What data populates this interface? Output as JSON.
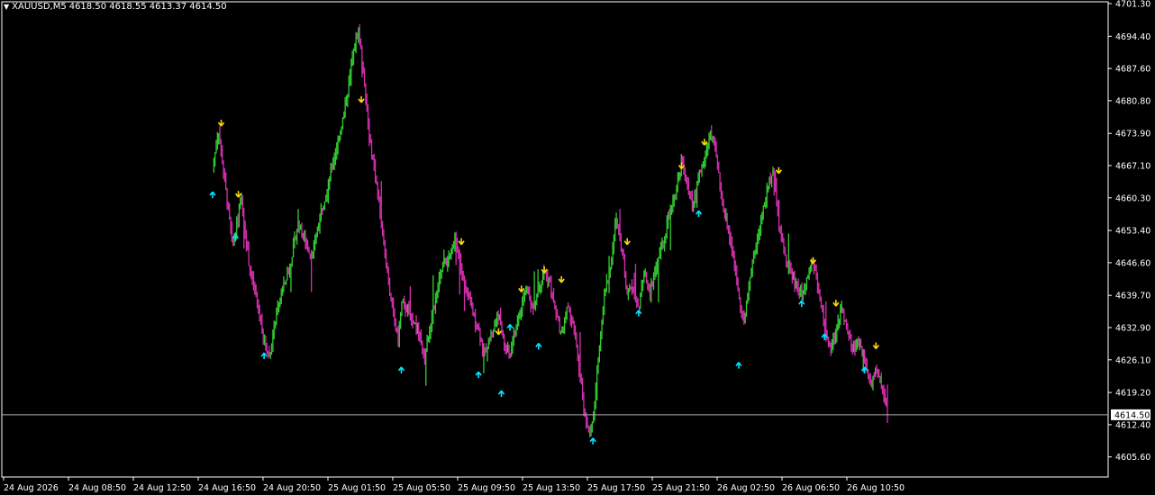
{
  "header": {
    "symbol": "XAUUSD,M5",
    "ohlc": "4618.50 4618.55 4613.37 4614.50"
  },
  "current_price": "4614.50",
  "colors": {
    "background": "#000000",
    "up": "#32cd32",
    "down": "#d62fae",
    "up_arrow": "#00e5ff",
    "down_arrow": "#ffd700",
    "axis": "#ffffff",
    "price_line": "#c0c0c0"
  },
  "chart_data": {
    "type": "candlestick",
    "symbol": "XAUUSD",
    "timeframe": "M5",
    "ylim": [
      4602.5,
      4701.3
    ],
    "y_ticks": [
      "4701.30",
      "4694.40",
      "4687.60",
      "4680.80",
      "4673.90",
      "4667.10",
      "4660.30",
      "4653.40",
      "4646.60",
      "4639.70",
      "4632.90",
      "4626.10",
      "4619.20",
      "4612.40",
      "4605.60"
    ],
    "x_ticks": [
      "24 Aug 2026",
      "24 Aug 08:50",
      "24 Aug 12:50",
      "24 Aug 16:50",
      "24 Aug 20:50",
      "25 Aug 01:50",
      "25 Aug 05:50",
      "25 Aug 09:50",
      "25 Aug 13:50",
      "25 Aug 17:50",
      "25 Aug 21:50",
      "26 Aug 02:50",
      "26 Aug 06:50",
      "26 Aug 10:50"
    ],
    "price_path": [
      [
        0.0,
        4666
      ],
      [
        0.02,
        4675
      ],
      [
        0.04,
        4665
      ],
      [
        0.07,
        4650
      ],
      [
        0.1,
        4660
      ],
      [
        0.13,
        4645
      ],
      [
        0.16,
        4637
      ],
      [
        0.18,
        4630
      ],
      [
        0.2,
        4627
      ],
      [
        0.22,
        4635
      ],
      [
        0.24,
        4640
      ],
      [
        0.27,
        4646
      ],
      [
        0.3,
        4655
      ],
      [
        0.33,
        4650
      ],
      [
        0.35,
        4648
      ],
      [
        0.38,
        4658
      ],
      [
        0.4,
        4662
      ],
      [
        0.43,
        4670
      ],
      [
        0.46,
        4678
      ],
      [
        0.49,
        4690
      ],
      [
        0.51,
        4696
      ],
      [
        0.53,
        4685
      ],
      [
        0.55,
        4672
      ],
      [
        0.57,
        4665
      ],
      [
        0.6,
        4650
      ],
      [
        0.62,
        4640
      ],
      [
        0.65,
        4630
      ],
      [
        0.66,
        4638
      ],
      [
        0.69,
        4636
      ],
      [
        0.72,
        4632
      ],
      [
        0.74,
        4626
      ],
      [
        0.77,
        4636
      ],
      [
        0.8,
        4645
      ],
      [
        0.83,
        4648
      ],
      [
        0.85,
        4652
      ],
      [
        0.87,
        4645
      ],
      [
        0.89,
        4640
      ],
      [
        0.91,
        4636
      ],
      [
        0.93,
        4633
      ],
      [
        0.95,
        4627
      ],
      [
        0.97,
        4631
      ],
      [
        1.0,
        4636
      ],
      [
        1.02,
        4629
      ],
      [
        1.04,
        4627
      ],
      [
        1.06,
        4633
      ],
      [
        1.08,
        4637
      ],
      [
        1.1,
        4642
      ],
      [
        1.12,
        4636
      ],
      [
        1.14,
        4641
      ],
      [
        1.16,
        4645
      ],
      [
        1.18,
        4642
      ],
      [
        1.2,
        4636
      ],
      [
        1.22,
        4631
      ],
      [
        1.24,
        4637
      ],
      [
        1.26,
        4634
      ],
      [
        1.28,
        4625
      ],
      [
        1.3,
        4615
      ],
      [
        1.32,
        4610
      ],
      [
        1.33,
        4613
      ],
      [
        1.35,
        4627
      ],
      [
        1.37,
        4640
      ],
      [
        1.39,
        4645
      ],
      [
        1.41,
        4656
      ],
      [
        1.43,
        4650
      ],
      [
        1.45,
        4640
      ],
      [
        1.47,
        4642
      ],
      [
        1.49,
        4637
      ],
      [
        1.51,
        4645
      ],
      [
        1.53,
        4640
      ],
      [
        1.56,
        4648
      ],
      [
        1.58,
        4652
      ],
      [
        1.6,
        4658
      ],
      [
        1.62,
        4662
      ],
      [
        1.64,
        4668
      ],
      [
        1.66,
        4663
      ],
      [
        1.68,
        4658
      ],
      [
        1.7,
        4665
      ],
      [
        1.72,
        4668
      ],
      [
        1.74,
        4674
      ],
      [
        1.76,
        4670
      ],
      [
        1.78,
        4660
      ],
      [
        1.8,
        4655
      ],
      [
        1.82,
        4648
      ],
      [
        1.84,
        4640
      ],
      [
        1.86,
        4634
      ],
      [
        1.88,
        4644
      ],
      [
        1.9,
        4650
      ],
      [
        1.92,
        4656
      ],
      [
        1.94,
        4662
      ],
      [
        1.96,
        4667
      ],
      [
        1.98,
        4655
      ],
      [
        2.0,
        4648
      ],
      [
        2.02,
        4645
      ],
      [
        2.04,
        4642
      ],
      [
        2.06,
        4640
      ],
      [
        2.08,
        4644
      ],
      [
        2.1,
        4647
      ],
      [
        2.12,
        4640
      ],
      [
        2.14,
        4633
      ],
      [
        2.16,
        4628
      ],
      [
        2.18,
        4632
      ],
      [
        2.2,
        4637
      ],
      [
        2.22,
        4632
      ],
      [
        2.24,
        4628
      ],
      [
        2.26,
        4630
      ],
      [
        2.28,
        4626
      ],
      [
        2.3,
        4621
      ],
      [
        2.32,
        4624
      ],
      [
        2.34,
        4621
      ],
      [
        2.36,
        4614.5
      ]
    ],
    "up_arrows": [
      [
        0.0,
        4661
      ],
      [
        0.08,
        4652
      ],
      [
        0.18,
        4627
      ],
      [
        0.66,
        4624
      ],
      [
        0.93,
        4623
      ],
      [
        1.01,
        4619
      ],
      [
        1.04,
        4633
      ],
      [
        1.14,
        4629
      ],
      [
        1.33,
        4609
      ],
      [
        1.49,
        4636
      ],
      [
        1.7,
        4657
      ],
      [
        1.84,
        4625
      ],
      [
        2.06,
        4638
      ],
      [
        2.14,
        4631
      ],
      [
        2.28,
        4624
      ]
    ],
    "down_arrows": [
      [
        0.03,
        4676
      ],
      [
        0.09,
        4661
      ],
      [
        0.52,
        4681
      ],
      [
        0.87,
        4651
      ],
      [
        1.0,
        4632
      ],
      [
        1.08,
        4641
      ],
      [
        1.16,
        4645
      ],
      [
        1.22,
        4643
      ],
      [
        1.45,
        4651
      ],
      [
        1.64,
        4667
      ],
      [
        1.72,
        4672
      ],
      [
        1.98,
        4666
      ],
      [
        2.1,
        4647
      ],
      [
        2.18,
        4638
      ],
      [
        2.32,
        4629
      ]
    ]
  }
}
